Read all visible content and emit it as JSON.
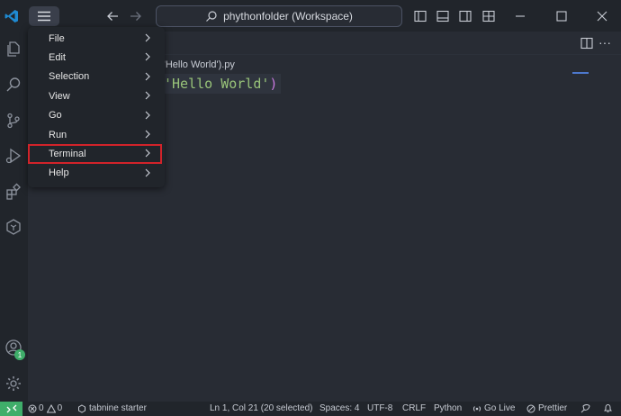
{
  "titlebar": {
    "search_text": "phythonfolder (Workspace)"
  },
  "editor": {
    "tab_path": "t('Hello World').py",
    "code": {
      "open_paren": "(",
      "string": "'Hello World'",
      "close_paren": ")"
    }
  },
  "menu": {
    "items": [
      {
        "label": "File"
      },
      {
        "label": "Edit"
      },
      {
        "label": "Selection"
      },
      {
        "label": "View"
      },
      {
        "label": "Go"
      },
      {
        "label": "Run"
      },
      {
        "label": "Terminal"
      },
      {
        "label": "Help"
      }
    ],
    "highlighted": "Terminal",
    "highlight_color": "#d2232a"
  },
  "activitybar": {
    "accounts_badge": "1"
  },
  "statusbar": {
    "errors": "0",
    "warnings": "0",
    "tabnine": "tabnine starter",
    "position": "Ln 1, Col 21 (20 selected)",
    "spaces": "Spaces: 4",
    "encoding": "UTF-8",
    "eol": "CRLF",
    "language": "Python",
    "golive": "Go Live",
    "prettier": "Prettier"
  },
  "colors": {
    "remote": "#3fae6a",
    "string": "#98c379",
    "vscode_blue": "#1f8ad2"
  }
}
